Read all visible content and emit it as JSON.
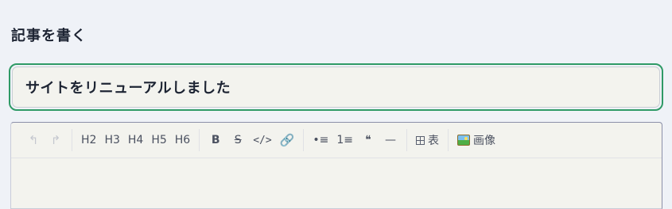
{
  "page": {
    "heading": "記事を書く"
  },
  "title_input": {
    "value": "サイトをリニューアルしました"
  },
  "toolbar": {
    "undo_icon": "undo-icon",
    "redo_icon": "redo-icon",
    "headings": [
      "H2",
      "H3",
      "H4",
      "H5",
      "H6"
    ],
    "bold_label": "B",
    "strike_label": "S",
    "code_label": "</>",
    "link_icon": "link-icon",
    "bullet_list_label": "•≡",
    "ordered_list_label": "1≡",
    "quote_label": "❝",
    "hr_label": "—",
    "table_label": "表",
    "image_label": "画像"
  },
  "colors": {
    "focus_ring": "#2f9a66",
    "background": "#eff2f7",
    "field_background": "#f3f3ee"
  }
}
